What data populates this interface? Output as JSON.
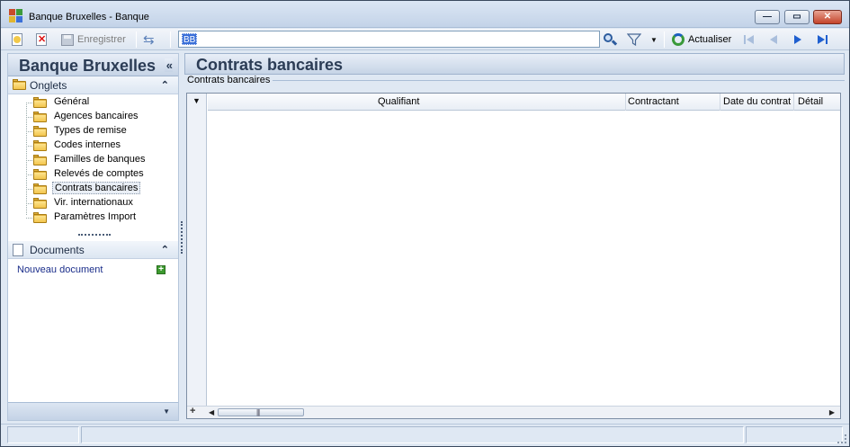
{
  "window": {
    "title": "Banque Bruxelles -  Banque",
    "buttons": {
      "minimize": "—",
      "maximize": "▭",
      "close": "✕"
    }
  },
  "toolbar": {
    "save_label": "Enregistrer",
    "search_value": "BB",
    "refresh_label": "Actualiser"
  },
  "left": {
    "header": "Banque Bruxelles",
    "collapse": "«",
    "tabs_section": "Onglets",
    "tabs_chevron": "⌃",
    "items": [
      {
        "label": "Général"
      },
      {
        "label": "Agences bancaires"
      },
      {
        "label": "Types de remise"
      },
      {
        "label": "Codes internes"
      },
      {
        "label": "Familles de banques"
      },
      {
        "label": "Relevés de comptes"
      },
      {
        "label": "Contrats bancaires",
        "selected": true
      },
      {
        "label": "Vir. internationaux"
      },
      {
        "label": "Paramètres Import"
      }
    ],
    "documents_section": "Documents",
    "documents_chevron": "⌃",
    "new_document": "Nouveau document"
  },
  "main": {
    "title": "Contrats bancaires",
    "group_label": "Contrats bancaires",
    "columns": [
      "Qualifiant",
      "Contractant",
      "Date du contrat",
      "Détail"
    ],
    "rows": []
  },
  "colors": {
    "accent": "#2b3c55",
    "link": "#1a2d8a",
    "selection": "#3a6fd8",
    "add_green": "#3d9a2f"
  }
}
